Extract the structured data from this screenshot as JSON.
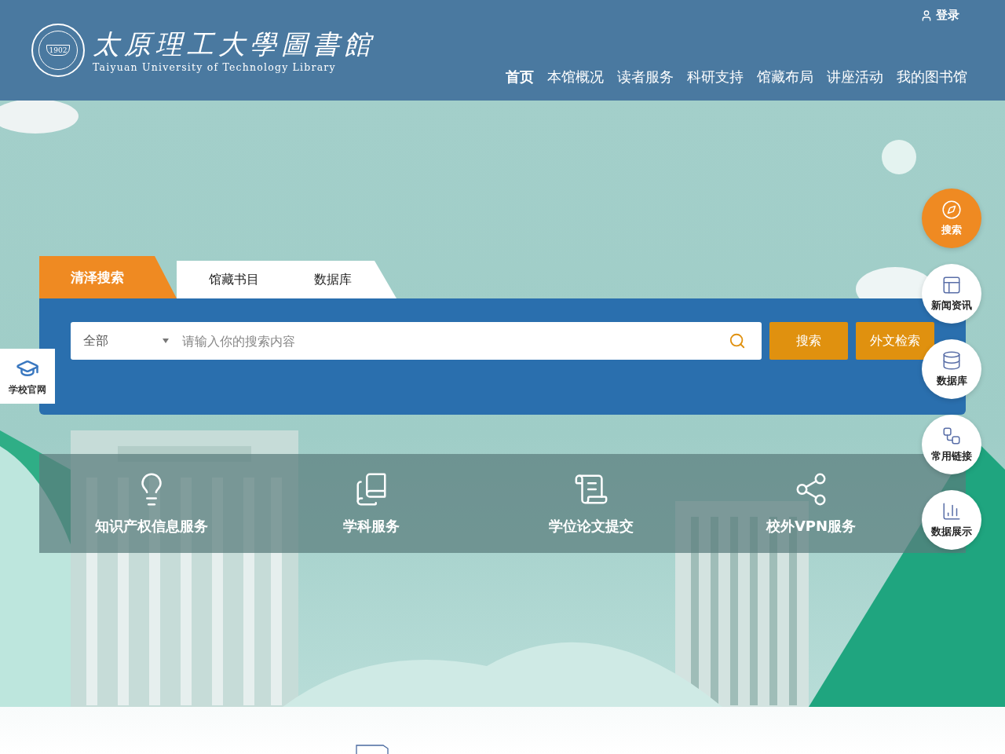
{
  "header": {
    "logo": {
      "seal_year": "1902",
      "title": "太原理工大學圖書館",
      "subtitle": "Taiyuan University of Technology Library"
    },
    "login": "登录",
    "nav": [
      {
        "label": "首页",
        "selected": true
      },
      {
        "label": "本馆概况",
        "selected": false
      },
      {
        "label": "读者服务",
        "selected": false
      },
      {
        "label": "科研支持",
        "selected": false
      },
      {
        "label": "馆藏布局",
        "selected": false
      },
      {
        "label": "讲座活动",
        "selected": false
      },
      {
        "label": "我的图书馆",
        "selected": false
      }
    ]
  },
  "left_badge": {
    "label": "学校官网"
  },
  "search": {
    "tabs": [
      {
        "label": "清泽搜索",
        "selected": true
      },
      {
        "label": "馆藏书目",
        "selected": false
      },
      {
        "label": "数据库",
        "selected": false
      }
    ],
    "scope": "全部",
    "placeholder": "请输入你的搜索内容",
    "buttons": [
      "搜索",
      "外文检索"
    ]
  },
  "services": [
    {
      "label": "知识产权信息服务",
      "kind": "bulb"
    },
    {
      "label": "学科服务",
      "kind": "books"
    },
    {
      "label": "学位论文提交",
      "kind": "scroll"
    },
    {
      "label": "校外VPN服务",
      "kind": "network"
    }
  ],
  "side_menu": [
    {
      "label": "搜索",
      "kind": "compass",
      "selected": true
    },
    {
      "label": "新闻资讯",
      "kind": "news",
      "selected": false
    },
    {
      "label": "数据库",
      "kind": "database",
      "selected": false
    },
    {
      "label": "常用链接",
      "kind": "link",
      "selected": false
    },
    {
      "label": "数据展示",
      "kind": "chart",
      "selected": false
    }
  ]
}
